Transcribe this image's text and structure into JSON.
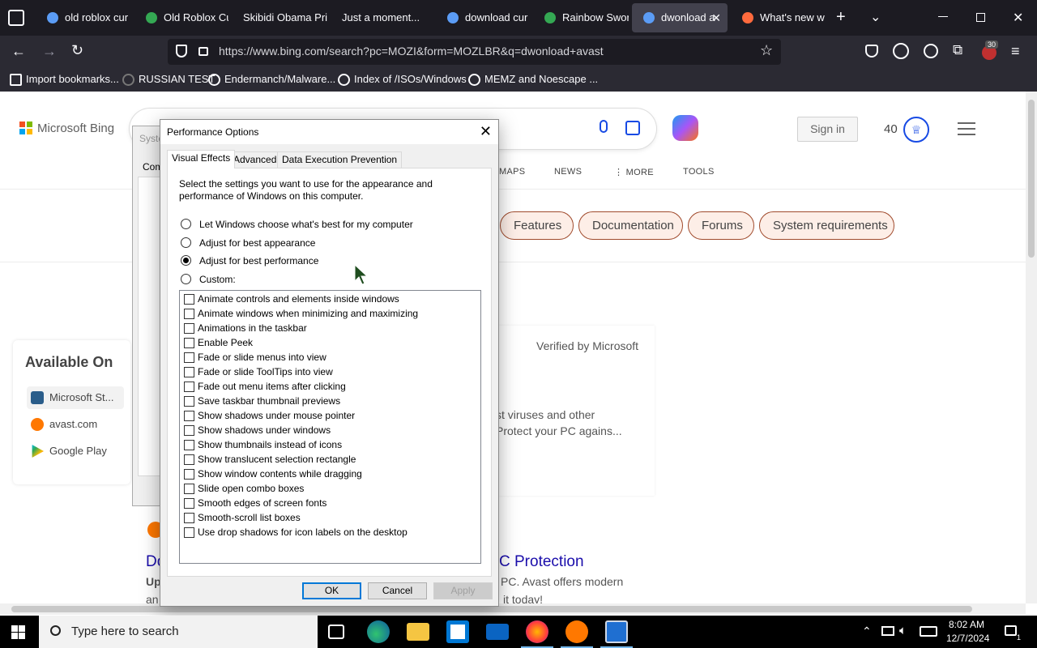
{
  "browser": {
    "tabs": [
      {
        "label": "old roblox cur",
        "icon_color": "#5b9cf5"
      },
      {
        "label": "Old Roblox Cu",
        "icon_color": "#34a853"
      },
      {
        "label": "Skibidi Obama Pri",
        "icon_color": "#cccccc"
      },
      {
        "label": "Just a moment...",
        "icon_color": "#cccccc"
      },
      {
        "label": "download cur",
        "icon_color": "#5b9cf5"
      },
      {
        "label": "Rainbow Swor",
        "icon_color": "#34a853"
      },
      {
        "label": "dwonload a",
        "icon_color": "#5b9cf5",
        "active": true
      },
      {
        "label": "What's new w",
        "icon_color": "#ff6a3d"
      }
    ],
    "url": "https://www.bing.com/search?pc=MOZI&form=MOZLBR&q=dwonload+avast",
    "extension_badge": "30",
    "bookmarks": [
      "Import bookmarks...",
      "RUSSIAN TEST",
      "Endermanch/Malware...",
      "Index of /ISOs/Windows",
      "MEMZ and Noescape ..."
    ]
  },
  "bing": {
    "logo": "Microsoft Bing",
    "sign_in": "Sign in",
    "rewards_points": "40",
    "scopes": [
      "MAPS",
      "NEWS",
      "MORE",
      "TOOLS"
    ],
    "pills": [
      "Features",
      "Documentation",
      "Forums",
      "System requirements"
    ],
    "available_on": {
      "title": "Available On",
      "items": [
        "Microsoft St...",
        "avast.com",
        "Google Play"
      ]
    },
    "card": {
      "verified": "Verified by Microsoft",
      "snippet_line1": "st viruses and other",
      "snippet_line2": "Protect your PC agains..."
    },
    "result": {
      "title_left": "Do",
      "title_right": "C Protection",
      "text_left": "Up",
      "text_right": "PC. Avast offers modern",
      "text2_left": "an",
      "text2_right": "it today!"
    }
  },
  "background_window": {
    "title_fragment": "Syste",
    "tab_fragment": "Com"
  },
  "dialog": {
    "title": "Performance Options",
    "tabs": [
      "Visual Effects",
      "Advanced",
      "Data Execution Prevention"
    ],
    "description": "Select the settings you want to use for the appearance and performance of Windows on this computer.",
    "radio_options": [
      {
        "label": "Let Windows choose what's best for my computer",
        "selected": false
      },
      {
        "label": "Adjust for best appearance",
        "selected": false
      },
      {
        "label": "Adjust for best performance",
        "selected": true
      },
      {
        "label": "Custom:",
        "selected": false
      }
    ],
    "effects": [
      "Animate controls and elements inside windows",
      "Animate windows when minimizing and maximizing",
      "Animations in the taskbar",
      "Enable Peek",
      "Fade or slide menus into view",
      "Fade or slide ToolTips into view",
      "Fade out menu items after clicking",
      "Save taskbar thumbnail previews",
      "Show shadows under mouse pointer",
      "Show shadows under windows",
      "Show thumbnails instead of icons",
      "Show translucent selection rectangle",
      "Show window contents while dragging",
      "Slide open combo boxes",
      "Smooth edges of screen fonts",
      "Smooth-scroll list boxes",
      "Use drop shadows for icon labels on the desktop"
    ],
    "buttons": {
      "ok": "OK",
      "cancel": "Cancel",
      "apply": "Apply"
    }
  },
  "taskbar": {
    "search_placeholder": "Type here to search",
    "time": "8:02 AM",
    "date": "12/7/2024",
    "notification_count": "1"
  }
}
